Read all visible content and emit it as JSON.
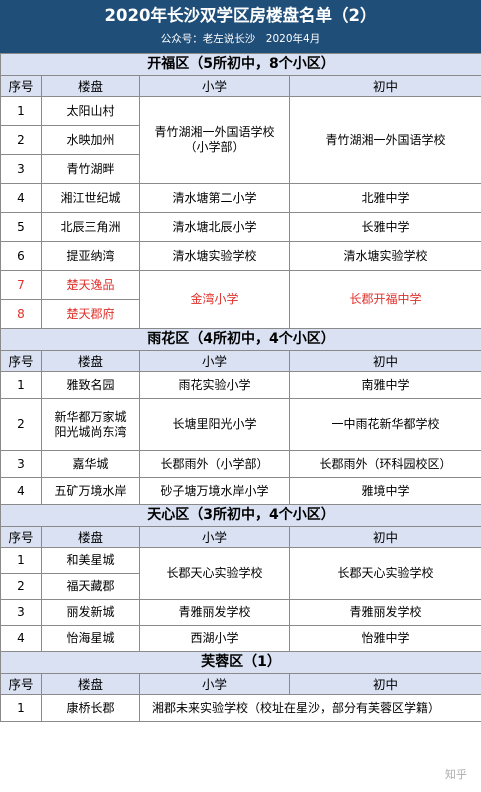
{
  "header": {
    "title": "2020年长沙双学区房楼盘名单（2）",
    "subtitle": "公众号：老左说长沙　2020年4月"
  },
  "columns": [
    "序号",
    "楼盘",
    "小学",
    "初中"
  ],
  "accent_red": "#e0312b",
  "header_bg": "#1f4e79",
  "section_bg": "#d9e1f2",
  "districts": [
    {
      "title": "开福区（5所初中，8个小区）",
      "groups": [
        {
          "estates": [
            {
              "no": "1",
              "name": "太阳山村"
            },
            {
              "no": "2",
              "name": "水映加州"
            },
            {
              "no": "3",
              "name": "青竹湖畔"
            }
          ],
          "primary": "青竹湖湘一外国语学校（小学部）",
          "middle": "青竹湖湘一外国语学校"
        },
        {
          "estates": [
            {
              "no": "4",
              "name": "湘江世纪城"
            }
          ],
          "primary": "清水塘第二小学",
          "middle": "北雅中学"
        },
        {
          "estates": [
            {
              "no": "5",
              "name": "北辰三角洲"
            }
          ],
          "primary": "清水塘北辰小学",
          "middle": "长雅中学"
        },
        {
          "estates": [
            {
              "no": "6",
              "name": "提亚纳湾"
            }
          ],
          "primary": "清水塘实验学校",
          "middle": "清水塘实验学校"
        },
        {
          "estates": [
            {
              "no": "7",
              "name": "楚天逸品"
            },
            {
              "no": "8",
              "name": "楚天郡府"
            }
          ],
          "primary": "金湾小学",
          "middle": "长郡开福中学",
          "red": true
        }
      ]
    },
    {
      "title": "雨花区（4所初中，4个小区）",
      "groups": [
        {
          "estates": [
            {
              "no": "1",
              "name": "雅致名园"
            }
          ],
          "primary": "雨花实验小学",
          "middle": "南雅中学"
        },
        {
          "estates": [
            {
              "no": "2",
              "name": "新华都万家城 阳光城尚东湾"
            }
          ],
          "primary": "长塘里阳光小学",
          "middle": "一中雨花新华都学校",
          "tall": true
        },
        {
          "estates": [
            {
              "no": "3",
              "name": "嘉华城"
            }
          ],
          "primary": "长郡雨外（小学部）",
          "middle": "长郡雨外（环科园校区）"
        },
        {
          "estates": [
            {
              "no": "4",
              "name": "五矿万境水岸"
            }
          ],
          "primary": "砂子塘万境水岸小学",
          "middle": "雅境中学"
        }
      ]
    },
    {
      "title": "天心区（3所初中，4个小区）",
      "groups": [
        {
          "estates": [
            {
              "no": "1",
              "name": "和美星城"
            },
            {
              "no": "2",
              "name": "福天藏郡"
            }
          ],
          "primary": "长郡天心实验学校",
          "middle": "长郡天心实验学校"
        },
        {
          "estates": [
            {
              "no": "3",
              "name": "丽发新城"
            }
          ],
          "primary": "青雅丽发学校",
          "middle": "青雅丽发学校"
        },
        {
          "estates": [
            {
              "no": "4",
              "name": "怡海星城"
            }
          ],
          "primary": "西湖小学",
          "middle": "怡雅中学"
        }
      ]
    },
    {
      "title": "芙蓉区（1）",
      "groups": [
        {
          "estates": [
            {
              "no": "1",
              "name": "康桥长郡"
            }
          ],
          "primary": "湘郡未来实验学校（校址在星沙，部分有芙蓉区学籍）",
          "span": true
        }
      ]
    }
  ],
  "watermark": "知乎"
}
